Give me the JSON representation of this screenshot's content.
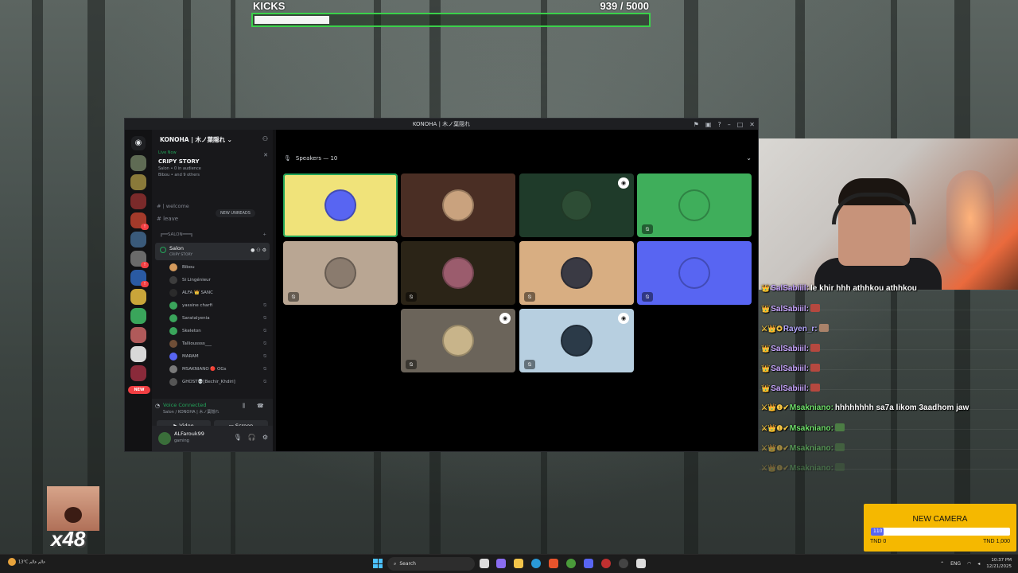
{
  "kicks": {
    "label": "KICKS",
    "count": "939",
    "separator": "/",
    "goal": "5000",
    "progress": 0.188
  },
  "window": {
    "title": "KONOHA | 木ノ葉隠れ",
    "server_name": "KONOHA | 木ノ葉隠れ",
    "live": {
      "status": "Live Now",
      "title": "CRIPY STORY",
      "location": "Salon • 0 in audience",
      "people": "Bibou • and 9 others"
    },
    "channels": [
      {
        "name": "| welcome"
      },
      {
        "name": "leave"
      }
    ],
    "new_unreads": "NEW UNREADS",
    "category": "╔══SALON═══╗",
    "voice_channel": {
      "name": "Salon",
      "status": "CRIPY STORY"
    },
    "members": [
      {
        "name": "Bibou",
        "color": "#d49a5c"
      },
      {
        "name": "Si Lingénieur",
        "color": "#3d3d3d"
      },
      {
        "name": "ALFA 👑 SANC",
        "color": "#2b2b2b"
      },
      {
        "name": "yassine charfi",
        "color": "#3aa55b"
      },
      {
        "name": "Saratalyenia",
        "color": "#3aa55b"
      },
      {
        "name": "Skeleton",
        "color": "#3aa55b"
      },
      {
        "name": "Tallioussss___",
        "color": "#6f4e37"
      },
      {
        "name": "MARAM",
        "color": "#5865f2"
      },
      {
        "name": "MSAKNIANO 🔴 OGs",
        "color": "#7a7a7a"
      },
      {
        "name": "GHOST💀[Bechir_Khdiri]",
        "color": "#555"
      }
    ],
    "voice_connected": {
      "status": "Voice Connected",
      "where": "Salon / KONOHA | 木ノ葉隠れ",
      "video_label": "Video",
      "screen_label": "Screen"
    },
    "user": {
      "name": "ALFarouk99",
      "status": "gaming"
    },
    "speakers_header": "Speakers — 10",
    "tiles": [
      {
        "bg": "#f0e37a",
        "face": "#5865f2",
        "speaking": true,
        "muted": false,
        "badge": false
      },
      {
        "bg": "#4a2e24",
        "face": "#c9a27e",
        "speaking": false,
        "muted": false,
        "badge": false
      },
      {
        "bg": "#1f3b2a",
        "face": "#2d4d35",
        "speaking": false,
        "muted": false,
        "badge": true
      },
      {
        "bg": "#3fae5b",
        "face": "#3fae5b",
        "speaking": false,
        "muted": true,
        "badge": false
      },
      {
        "bg": "#b9a693",
        "face": "#8a7b6e",
        "speaking": false,
        "muted": true,
        "badge": false
      },
      {
        "bg": "#2b2417",
        "face": "#9b5c6d",
        "speaking": false,
        "muted": true,
        "badge": false
      },
      {
        "bg": "#d8ae82",
        "face": "#3a3a44",
        "speaking": false,
        "muted": true,
        "badge": false
      },
      {
        "bg": "#5865f2",
        "face": "#5865f2",
        "speaking": false,
        "muted": true,
        "badge": false
      },
      {
        "bg": "#6b645a",
        "face": "#c8b48a",
        "speaking": false,
        "muted": true,
        "badge": true
      },
      {
        "bg": "#b7cfe0",
        "face": "#2b3a48",
        "speaking": false,
        "muted": true,
        "badge": true
      }
    ]
  },
  "chat": [
    {
      "name": "SalSabiiil:",
      "color": "#c9a7ff",
      "icons": "👑",
      "message": "le khir hhh athhkou athhkou",
      "emote": ""
    },
    {
      "name": "SalSabiiil:",
      "color": "#c9a7ff",
      "icons": "👑",
      "message": "",
      "emote": "#b5483f"
    },
    {
      "name": "Rayen_r:",
      "color": "#b6a8ff",
      "icons": "⚔👑✪",
      "message": "",
      "emote": "#a9826a"
    },
    {
      "name": "SalSabiiil:",
      "color": "#c9a7ff",
      "icons": "👑",
      "message": "",
      "emote": "#b5483f"
    },
    {
      "name": "SalSabiiil:",
      "color": "#c9a7ff",
      "icons": "👑",
      "message": "",
      "emote": "#b5483f"
    },
    {
      "name": "SalSabiiil:",
      "color": "#c9a7ff",
      "icons": "👑",
      "message": "",
      "emote": "#b5483f"
    },
    {
      "name": "Msakniano:",
      "color": "#6fe06a",
      "icons": "⚔👑❶✔",
      "message": "hhhhhhhh sa7a likom 3aadhom jaw",
      "emote": ""
    },
    {
      "name": "Msakniano:",
      "color": "#6fe06a",
      "icons": "⚔👑❶✔",
      "message": "",
      "emote": "#4c7d44"
    },
    {
      "name": "Msakniano:",
      "color": "#6fe06a",
      "icons": "⚔👑❶✔",
      "message": "",
      "emote": "#4c7d44"
    },
    {
      "name": "Msakniano:",
      "color": "#6fe06a",
      "icons": "⚔👑❶✔",
      "message": "",
      "emote": "#4c7d44"
    }
  ],
  "goal": {
    "title": "NEW CAMERA",
    "value": "110",
    "min": "TND 0",
    "max": "TND 1,000",
    "progress": 0.055
  },
  "emote_counter": "x48",
  "taskbar": {
    "weather_temp": "13°C",
    "weather_desc": "عالم عالم",
    "search_label": "Search",
    "lang": "ENG",
    "time": "10:37 PM",
    "date": "12/21/2025"
  }
}
